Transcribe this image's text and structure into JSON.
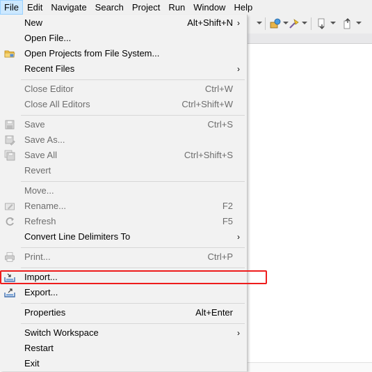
{
  "menubar": {
    "items": [
      "File",
      "Edit",
      "Navigate",
      "Search",
      "Project",
      "Run",
      "Window",
      "Help"
    ]
  },
  "file_menu": {
    "items": [
      {
        "label": "New",
        "shortcut": "Alt+Shift+N",
        "submenu": true
      },
      {
        "label": "Open File...",
        "shortcut": ""
      },
      {
        "label": "Open Projects from File System...",
        "shortcut": "",
        "icon": "folder-icon"
      },
      {
        "label": "Recent Files",
        "shortcut": "",
        "submenu": true
      },
      {
        "label": "Close Editor",
        "shortcut": "Ctrl+W",
        "disabled": true
      },
      {
        "label": "Close All Editors",
        "shortcut": "Ctrl+Shift+W",
        "disabled": true
      },
      {
        "label": "Save",
        "shortcut": "Ctrl+S",
        "disabled": true,
        "icon": "save-icon"
      },
      {
        "label": "Save As...",
        "shortcut": "",
        "disabled": true,
        "icon": "save-as-icon"
      },
      {
        "label": "Save All",
        "shortcut": "Ctrl+Shift+S",
        "disabled": true,
        "icon": "save-all-icon"
      },
      {
        "label": "Revert",
        "shortcut": "",
        "disabled": true
      },
      {
        "label": "Move...",
        "shortcut": "",
        "disabled": true
      },
      {
        "label": "Rename...",
        "shortcut": "F2",
        "disabled": true,
        "icon": "rename-icon"
      },
      {
        "label": "Refresh",
        "shortcut": "F5",
        "disabled": true,
        "icon": "refresh-icon"
      },
      {
        "label": "Convert Line Delimiters To",
        "shortcut": "",
        "submenu": true
      },
      {
        "label": "Print...",
        "shortcut": "Ctrl+P",
        "disabled": true,
        "icon": "print-icon"
      },
      {
        "label": "Import...",
        "shortcut": "",
        "icon": "import-icon"
      },
      {
        "label": "Export...",
        "shortcut": "",
        "icon": "export-icon"
      },
      {
        "label": "Properties",
        "shortcut": "Alt+Enter"
      },
      {
        "label": "Switch Workspace",
        "shortcut": "",
        "submenu": true
      },
      {
        "label": "Restart",
        "shortcut": ""
      },
      {
        "label": "Exit",
        "shortcut": ""
      }
    ],
    "submenu_arrow": "›"
  },
  "colors": {
    "highlight_box": "#ee1c1c",
    "menu_background": "#f2f2f2",
    "disabled_text": "#6d6d6d"
  }
}
